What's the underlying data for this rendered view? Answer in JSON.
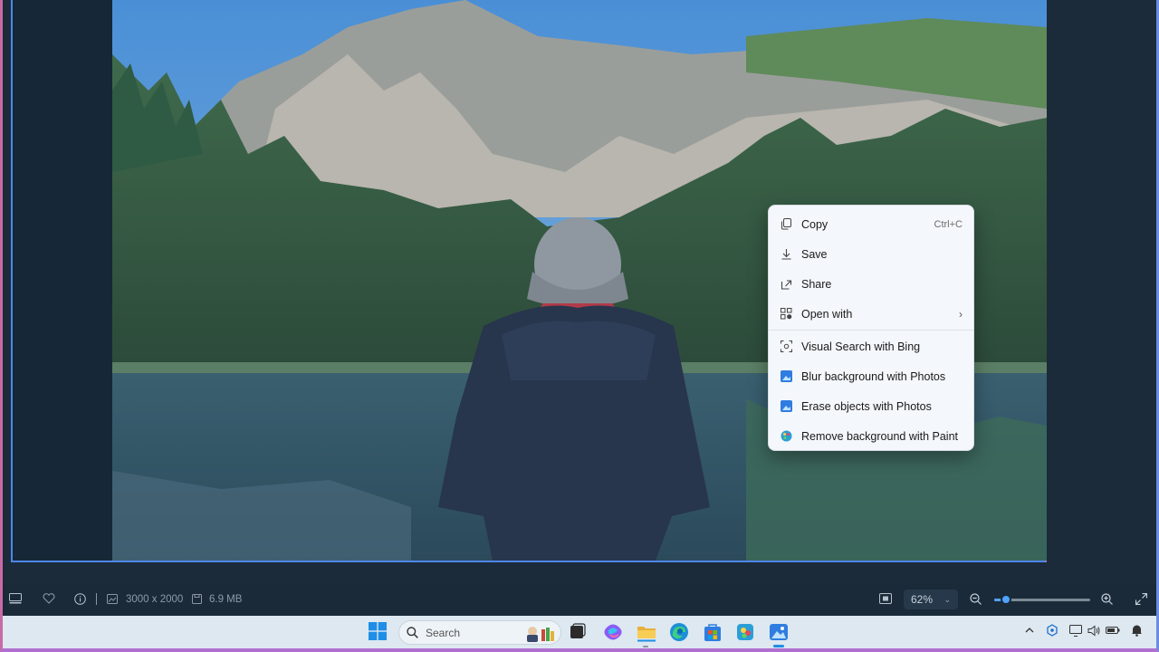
{
  "context_menu": {
    "items": [
      {
        "label": "Copy",
        "shortcut": "Ctrl+C",
        "icon": "copy-icon"
      },
      {
        "label": "Save",
        "icon": "download-icon"
      },
      {
        "label": "Share",
        "icon": "share-icon"
      },
      {
        "label": "Open with",
        "icon": "open-with-icon",
        "submenu_arrow": "›"
      },
      {
        "label": "Visual Search with Bing",
        "icon": "visual-search-icon"
      },
      {
        "label": "Blur background with Photos",
        "icon": "photos-app-icon"
      },
      {
        "label": "Erase objects with Photos",
        "icon": "photos-app-icon"
      },
      {
        "label": "Remove background with Paint",
        "icon": "paint-app-icon"
      }
    ]
  },
  "statusbar": {
    "dimensions": "3000 x 2000",
    "file_size": "6.9 MB",
    "zoom": "62%",
    "zoom_level": 0.12
  },
  "taskbar": {
    "search_placeholder": "Search"
  },
  "colors": {
    "accent": "#4fa3ff",
    "menu_bg": "#f4f7fb",
    "viewer_bg": "#1b2b3a",
    "taskbar_bg": "#dde8f1"
  }
}
